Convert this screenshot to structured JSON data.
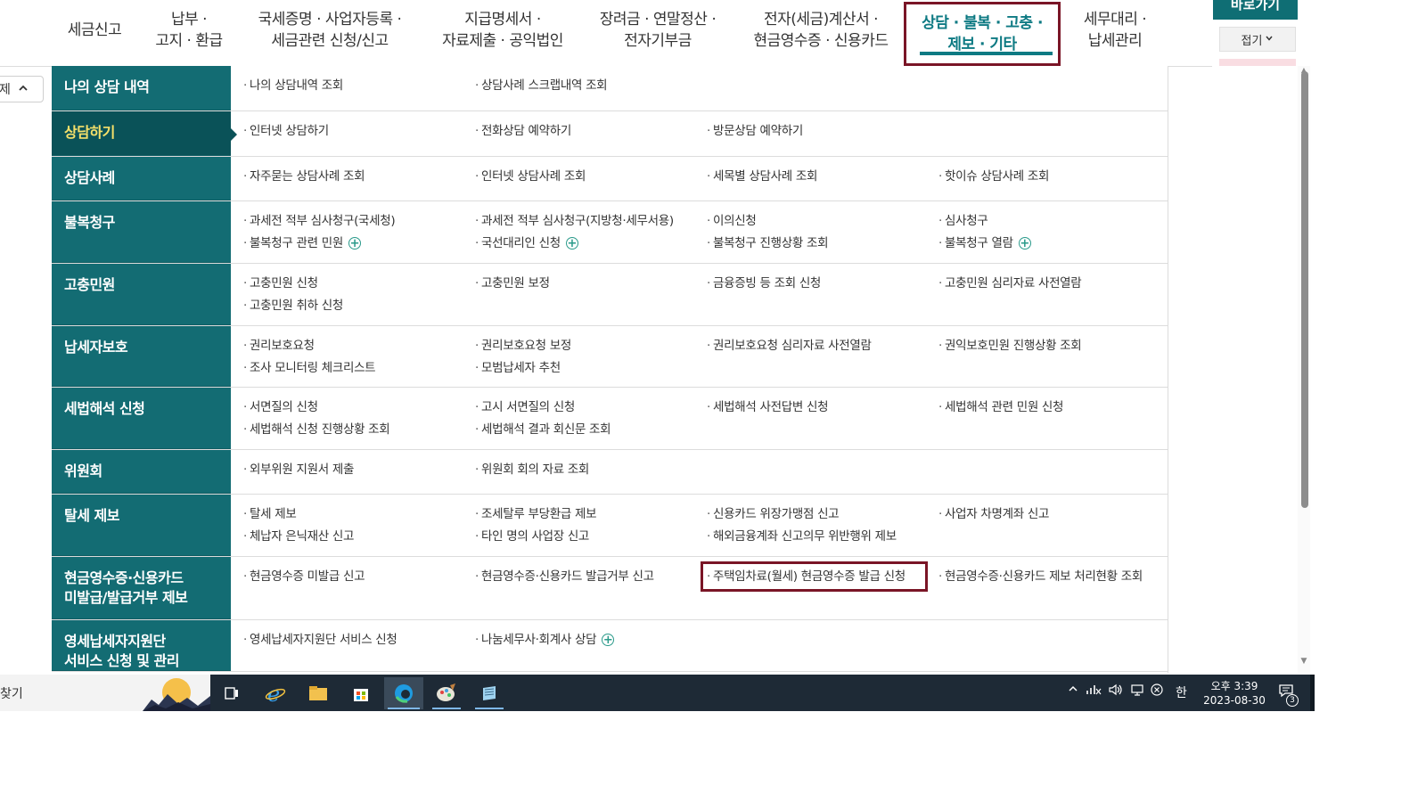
{
  "nav": {
    "items": [
      {
        "lines": [
          "세금신고"
        ]
      },
      {
        "lines": [
          "납부 ·",
          "고지 · 환급"
        ]
      },
      {
        "lines": [
          "국세증명 · 사업자등록 ·",
          "세금관련 신청/신고"
        ]
      },
      {
        "lines": [
          "지급명세서 ·",
          "자료제출 · 공익법인"
        ]
      },
      {
        "lines": [
          "장려금 · 연말정산 ·",
          "전자기부금"
        ]
      },
      {
        "lines": [
          "전자(세금)계산서 ·",
          "현금영수증 · 신용카드"
        ]
      },
      {
        "lines": [
          "상담 · 불복 · 고충 ·",
          "제보 · 기타"
        ]
      },
      {
        "lines": [
          "세무대리 ·",
          "납세관리"
        ]
      }
    ]
  },
  "quick": {
    "title": "바로가기",
    "collapse": "접기",
    "collapse_icon": "chevron-down-icon"
  },
  "left_toggle": {
    "label": "제",
    "icon": "chevron-up-icon"
  },
  "menu": {
    "rows": [
      {
        "cat": [
          "나의 상담 내역"
        ],
        "links": [
          [
            "나의 상담내역 조회",
            "상담사례 스크랩내역 조회"
          ]
        ]
      },
      {
        "cat": [
          "상담하기"
        ],
        "links": [
          [
            "인터넷 상담하기",
            "전화상담 예약하기",
            "방문상담 예약하기"
          ]
        ]
      },
      {
        "cat": [
          "상담사례"
        ],
        "links": [
          [
            "자주묻는 상담사례 조회",
            "인터넷 상담사례 조회",
            "세목별 상담사례 조회",
            "핫이슈 상담사례 조회"
          ]
        ]
      },
      {
        "cat": [
          "불복청구"
        ],
        "links": [
          [
            "과세전 적부 심사청구(국세청)",
            "과세전 적부 심사청구(지방청·세무서용)",
            "이의신청",
            "심사청구"
          ],
          [
            "불복청구 관련 민원",
            "국선대리인 신청",
            "불복청구 진행상황 조회",
            "불복청구 열람"
          ]
        ]
      },
      {
        "cat": [
          "고충민원"
        ],
        "links": [
          [
            "고충민원 신청",
            "고충민원 보정",
            "금융증빙 등 조회 신청",
            "고충민원 심리자료 사전열람"
          ],
          [
            "고충민원 취하 신청"
          ]
        ]
      },
      {
        "cat": [
          "납세자보호"
        ],
        "links": [
          [
            "권리보호요청",
            "권리보호요청 보정",
            "권리보호요청 심리자료 사전열람",
            "권익보호민원 진행상황 조회"
          ],
          [
            "조사 모니터링 체크리스트",
            "모범납세자 추천"
          ]
        ]
      },
      {
        "cat": [
          "세법해석 신청"
        ],
        "links": [
          [
            "서면질의 신청",
            "고시 서면질의 신청",
            "세법해석 사전답변 신청",
            "세법해석 관련 민원 신청"
          ],
          [
            "세법해석 신청 진행상황 조회",
            "세법해석 결과 회신문 조회"
          ]
        ]
      },
      {
        "cat": [
          "위원회"
        ],
        "links": [
          [
            "외부위원 지원서 제출",
            "위원회 회의 자료 조회"
          ]
        ]
      },
      {
        "cat": [
          "탈세 제보"
        ],
        "links": [
          [
            "탈세 제보",
            "조세탈루 부당환급 제보",
            "신용카드 위장가맹점 신고",
            "사업자 차명계좌 신고"
          ],
          [
            "체납자 은닉재산 신고",
            "타인 명의 사업장 신고",
            "해외금융계좌 신고의무 위반행위 제보"
          ]
        ]
      },
      {
        "cat": [
          "현금영수증·신용카드",
          "미발급/발급거부 제보"
        ],
        "links": [
          [
            "현금영수증 미발급 신고",
            "현금영수증·신용카드 발급거부 신고",
            "주택임차료(월세) 현금영수증 발급 신청",
            "현금영수증·신용카드 제보 처리현황 조회"
          ]
        ]
      },
      {
        "cat": [
          "영세납세자지원단",
          "서비스 신청 및 관리"
        ],
        "links": [
          [
            "영세납세자지원단 서비스 신청",
            "나눔세무사·회계사 상담"
          ]
        ]
      }
    ]
  },
  "taskbar": {
    "search_label": "찾기",
    "icons": [
      "task-view-icon",
      "internet-explorer-icon",
      "file-explorer-icon",
      "store-icon",
      "edge-icon",
      "paint-icon",
      "notepad-icon"
    ],
    "ime": "한",
    "time": "오후 3:39",
    "date": "2023-08-30",
    "notif_count": "3"
  },
  "colors": {
    "accent": "#136c73",
    "active_cat": "#0a5258",
    "highlight": "#7a1526",
    "active_text": "#f5e06a"
  }
}
